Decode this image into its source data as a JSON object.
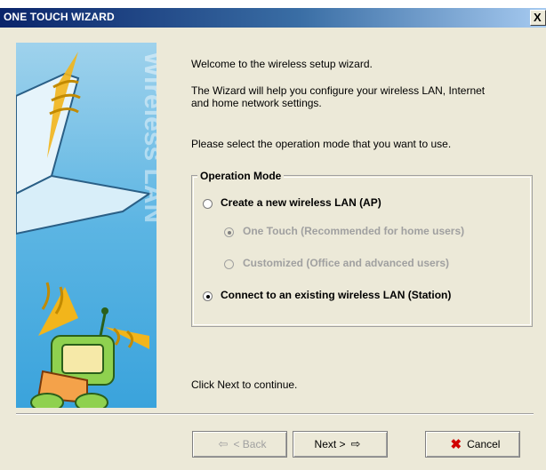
{
  "window": {
    "title": "ONE TOUCH WIZARD",
    "close_label": "X"
  },
  "left_panel": {
    "brand_text": "Wireless LAN"
  },
  "intro": {
    "line1": "Welcome to the wireless setup wizard.",
    "line2a": "The Wizard will help you configure your wireless LAN, Internet",
    "line2b": "and home network settings.",
    "line3": "Please select the operation mode that you want to use."
  },
  "operation_mode": {
    "label": "Operation Mode",
    "options": [
      {
        "label": "Create a new wireless LAN (AP)",
        "selected": false,
        "enabled": true
      },
      {
        "label": "One Touch (Recommended for home users)",
        "selected": true,
        "enabled": false
      },
      {
        "label": "Customized (Office and advanced users)",
        "selected": false,
        "enabled": false
      },
      {
        "label": "Connect to an existing wireless LAN (Station)",
        "selected": true,
        "enabled": true
      }
    ]
  },
  "footer_text": "Click Next to continue.",
  "buttons": {
    "back": {
      "label": "< Back",
      "enabled": false,
      "icon": "arrow-left-icon"
    },
    "next": {
      "label": "Next >",
      "enabled": true,
      "icon": "arrow-right-icon"
    },
    "cancel": {
      "label": "Cancel",
      "enabled": true,
      "icon": "red-x-icon"
    }
  },
  "colors": {
    "titlebar_start": "#0a246a",
    "titlebar_end": "#a6caf0",
    "dialog_bg": "#ece9d8",
    "panel_blue": "#5cb5e3",
    "cancel_icon": "#d00000"
  }
}
